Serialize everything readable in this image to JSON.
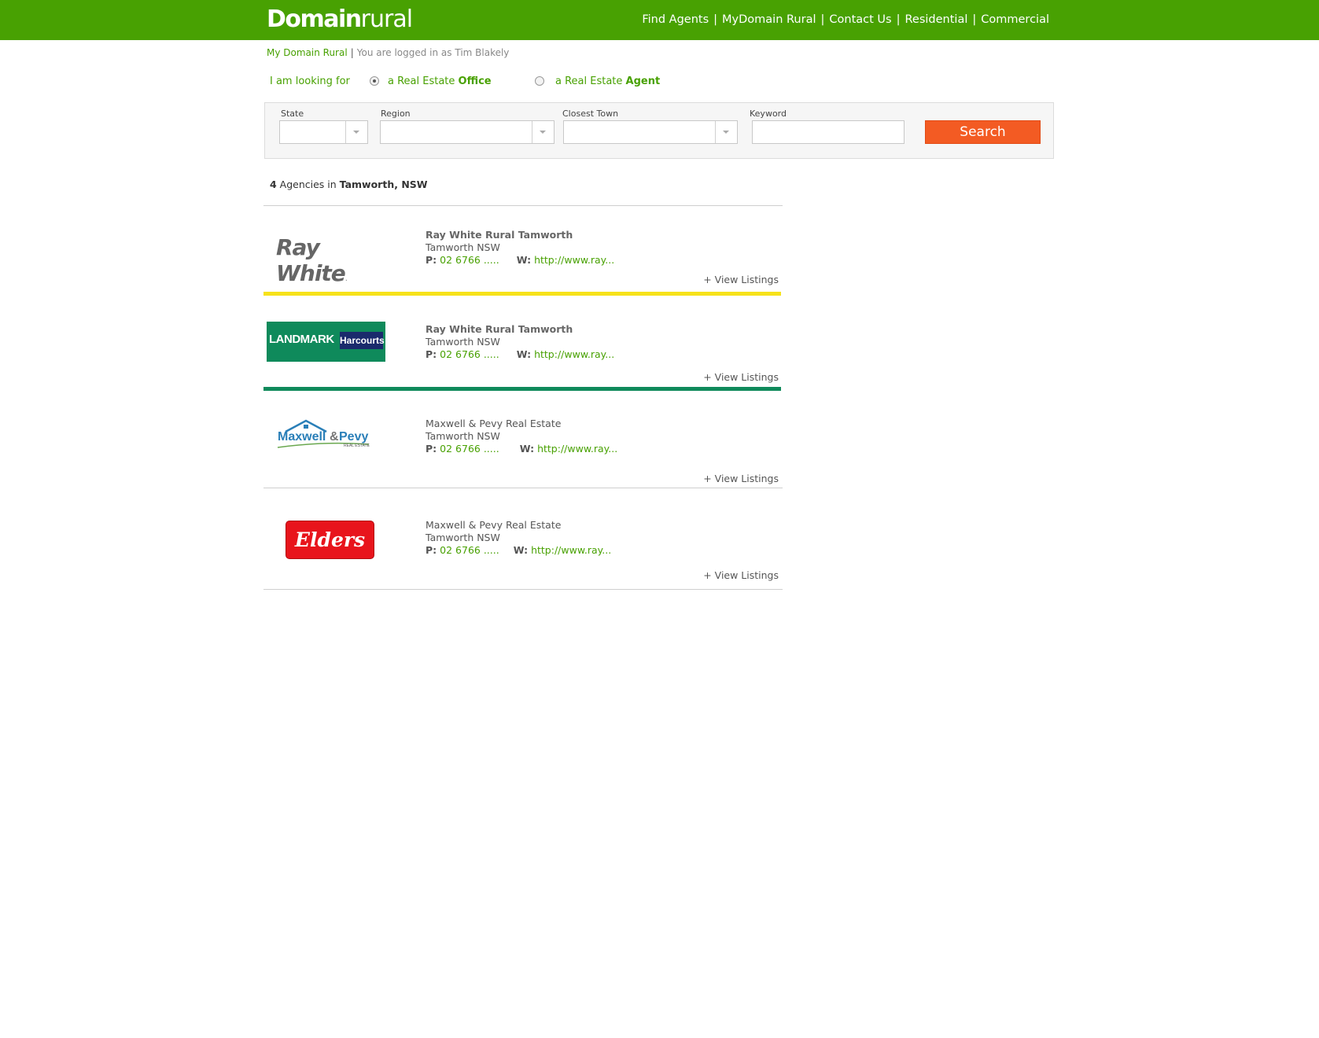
{
  "header": {
    "logo_bold": "Domain",
    "logo_light": "rural",
    "nav": [
      "Find Agents",
      "MyDomain Rural",
      "Contact Us",
      "Residential",
      "Commercial"
    ]
  },
  "breadcrumb": {
    "link": "My Domain Rural",
    "separator": "|",
    "status": "You are logged in as Tim Blakely"
  },
  "looking_for": {
    "label": "I am looking for",
    "option1_pre": "a Real Estate ",
    "option1_bold": "Office",
    "option2_pre": "a Real Estate ",
    "option2_bold": "Agent",
    "selected": "Office"
  },
  "search": {
    "state_label": "State",
    "region_label": "Region",
    "town_label": "Closest Town",
    "keyword_label": "Keyword",
    "state_value": "",
    "region_value": "",
    "town_value": "",
    "keyword_value": "",
    "button": "Search"
  },
  "results": {
    "count": "4",
    "mid": " Agencies in ",
    "location": "Tamworth, NSW"
  },
  "agencies": [
    {
      "logo_text": "Ray White",
      "logo_mark": ".",
      "name": "Ray White Rural Tamworth",
      "town": "Tamworth NSW",
      "p_label": "P:",
      "phone": "02 6766 .....",
      "w_label": "W:",
      "web": "http://www.ray...",
      "view": "+ View Listings",
      "accent": "#f7e21a"
    },
    {
      "logo_text": "LANDMARK",
      "logo_text2": "Harcourts",
      "name": "Ray White Rural Tamworth",
      "town": "Tamworth NSW",
      "p_label": "P:",
      "phone": "02 6766 .....",
      "w_label": "W:",
      "web": "http://www.ray...",
      "view": "+ View Listings",
      "accent": "#0f8a5b"
    },
    {
      "logo_text": "Maxwell",
      "logo_amp": "&",
      "logo_text2": "Pevy",
      "logo_sub": "REAL ESTATE",
      "name": "Maxwell & Pevy Real Estate",
      "town": "Tamworth NSW",
      "p_label": "P:",
      "phone": "02 6766 .....",
      "w_label": "W:",
      "web": "http://www.ray...",
      "view": "+ View Listings"
    },
    {
      "logo_text": "Elders",
      "name": "Maxwell & Pevy Real Estate",
      "town": "Tamworth NSW",
      "p_label": "P:",
      "phone": "02 6766 .....",
      "w_label": "W:",
      "web": "http://www.ray...",
      "view": "+ View Listings",
      "accent": "#e8141c"
    }
  ]
}
